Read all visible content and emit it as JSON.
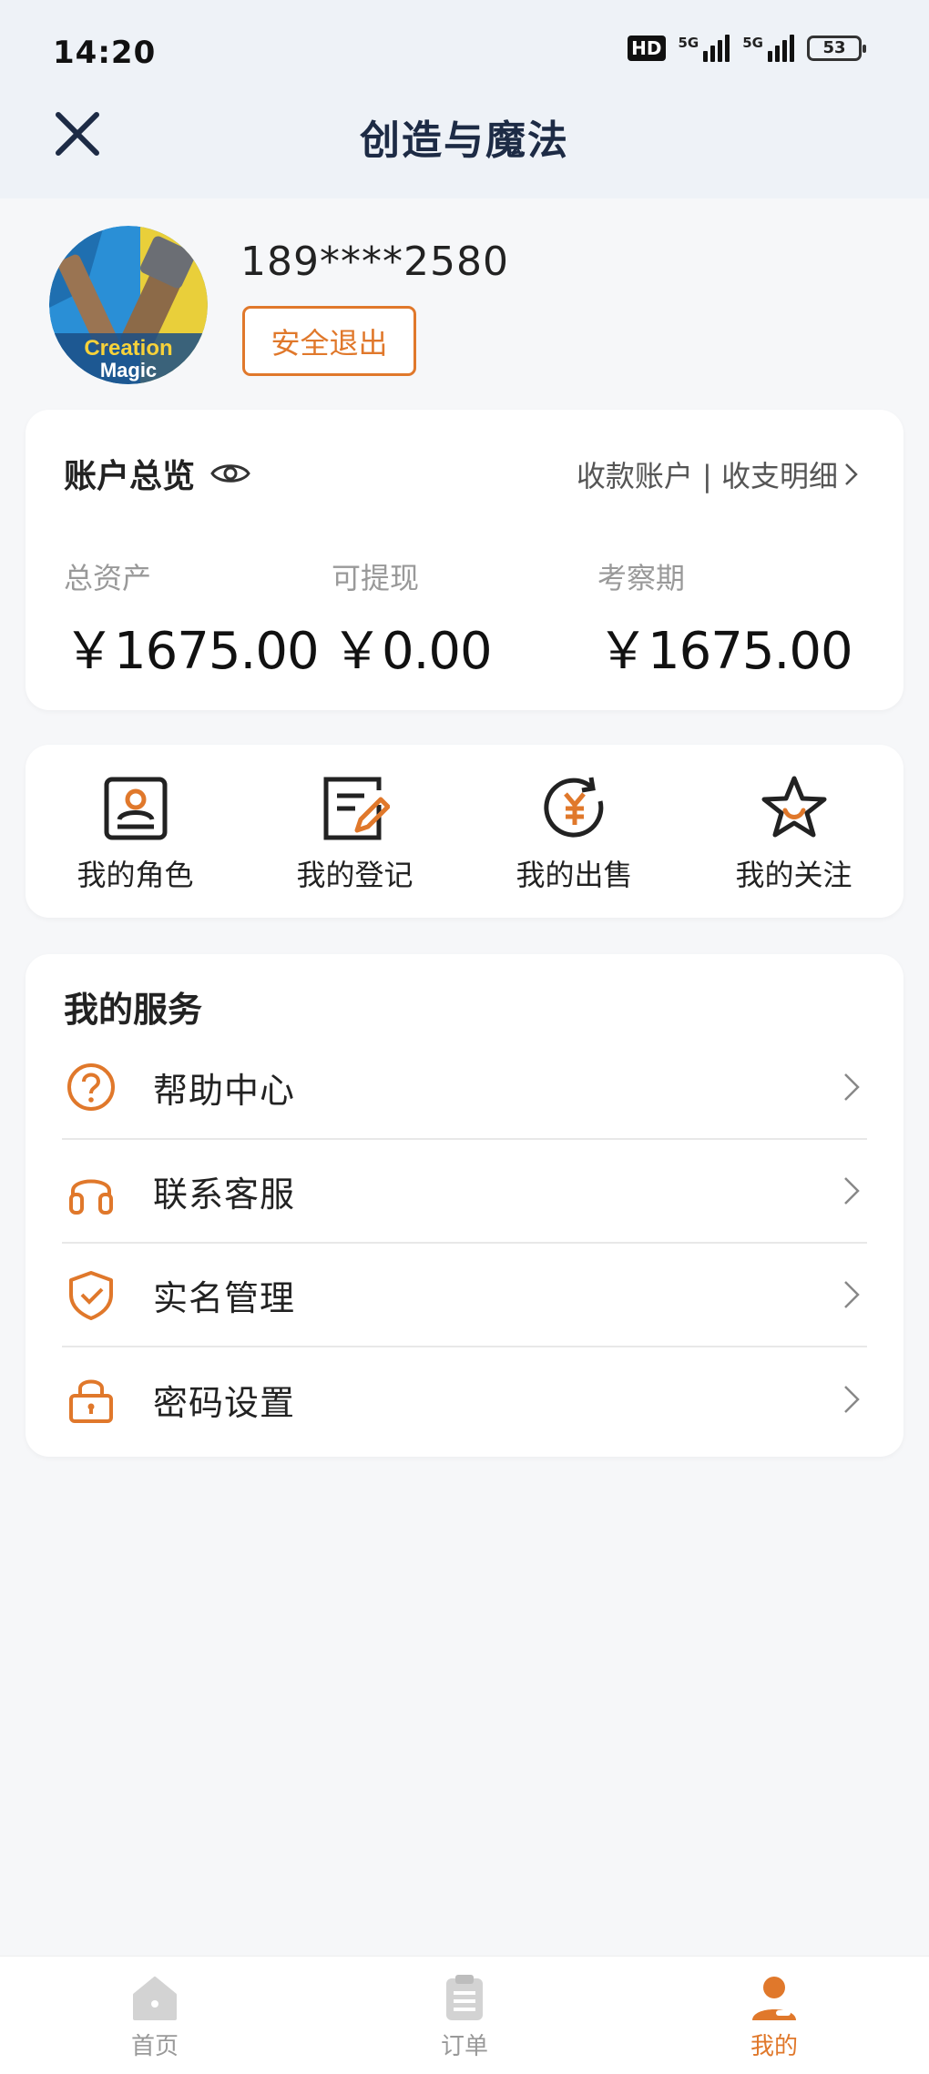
{
  "status_bar": {
    "time": "14:20",
    "hd_label": "HD",
    "network_1": "5G",
    "network_2": "5G",
    "battery": "53"
  },
  "header": {
    "title": "创造与魔法"
  },
  "profile": {
    "phone": "189****2580",
    "logout_label": "安全退出",
    "avatar_text": "Creation Magic"
  },
  "account": {
    "title": "账户总览",
    "links": "收款账户 | 收支明细",
    "stats": [
      {
        "label": "总资产",
        "value": "￥1675.00"
      },
      {
        "label": "可提现",
        "value": "￥0.00"
      },
      {
        "label": "考察期",
        "value": "￥1675.00"
      }
    ]
  },
  "quick_actions": [
    {
      "label": "我的角色",
      "icon": "role-card-icon"
    },
    {
      "label": "我的登记",
      "icon": "edit-note-icon"
    },
    {
      "label": "我的出售",
      "icon": "yen-cycle-icon"
    },
    {
      "label": "我的关注",
      "icon": "star-icon"
    }
  ],
  "services": {
    "title": "我的服务",
    "items": [
      {
        "label": "帮助中心",
        "icon": "help-icon"
      },
      {
        "label": "联系客服",
        "icon": "headset-icon"
      },
      {
        "label": "实名管理",
        "icon": "shield-check-icon"
      },
      {
        "label": "密码设置",
        "icon": "lock-icon"
      }
    ]
  },
  "tabbar": {
    "items": [
      {
        "label": "首页",
        "icon": "home-icon"
      },
      {
        "label": "订单",
        "icon": "clipboard-icon"
      },
      {
        "label": "我的",
        "icon": "user-icon"
      }
    ],
    "active_index": 2
  },
  "colors": {
    "accent": "#e0782b",
    "title": "#1d2b45",
    "background": "#f6f7f9"
  }
}
